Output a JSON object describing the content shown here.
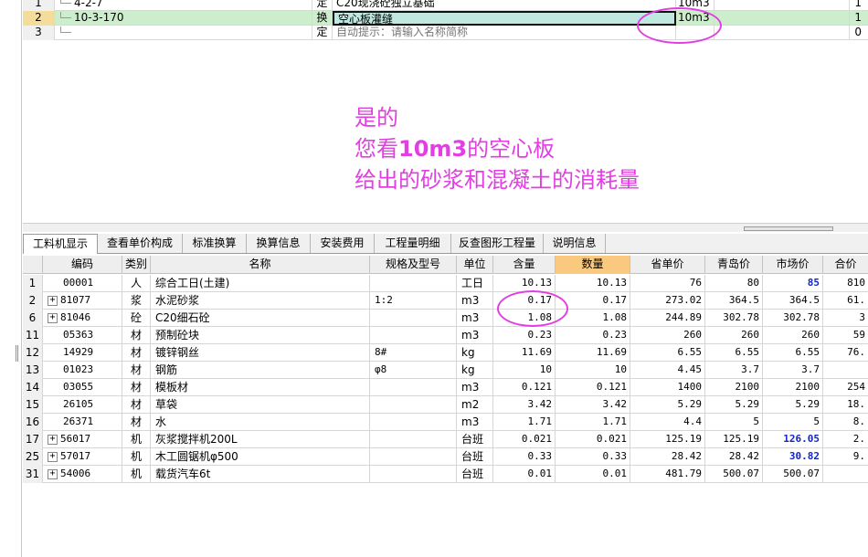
{
  "top_grid": {
    "rows": [
      {
        "num": "1",
        "code": "4-2-7",
        "type": "定",
        "name": "C20现浇砼独立基础",
        "unit": "10m3",
        "qty": "1",
        "selected": false
      },
      {
        "num": "2",
        "code": "10-3-170",
        "type": "换",
        "name": "空心板灌缝",
        "unit": "10m3",
        "qty": "1",
        "selected": true
      },
      {
        "num": "3",
        "code": "",
        "type": "定",
        "name": "自动提示：请输入名称简称",
        "unit": "",
        "qty": "0",
        "selected": false
      }
    ]
  },
  "annotation": {
    "line1": "是的",
    "line2_pre": "您看",
    "line2_bold": "10m3",
    "line2_post": "的空心板",
    "line3": "给出的砂浆和混凝土的消耗量",
    "color": "#e23fe2"
  },
  "tabs": [
    {
      "label": "工料机显示",
      "active": true
    },
    {
      "label": "查看单价构成",
      "active": false
    },
    {
      "label": "标准换算",
      "active": false
    },
    {
      "label": "换算信息",
      "active": false
    },
    {
      "label": "安装费用",
      "active": false
    },
    {
      "label": "工程量明细",
      "active": false
    },
    {
      "label": "反查图形工程量",
      "active": false
    },
    {
      "label": "说明信息",
      "active": false
    }
  ],
  "bottom_grid": {
    "headers": [
      "",
      "编码",
      "类别",
      "名称",
      "规格及型号",
      "单位",
      "含量",
      "数量",
      "省单价",
      "青岛价",
      "市场价",
      "合价"
    ],
    "rows": [
      {
        "rn": "1",
        "expand": false,
        "code": "00001",
        "cat": "人",
        "name": "综合工日(土建)",
        "spec": "",
        "unit": "工日",
        "content": "10.13",
        "qty": "10.13",
        "prov": "76",
        "qd": "80",
        "mkt": "85",
        "mkt_blue": true,
        "total": "810"
      },
      {
        "rn": "2",
        "expand": true,
        "code": "81077",
        "cat": "浆",
        "name": "水泥砂浆",
        "spec": "1:2",
        "unit": "m3",
        "content": "0.17",
        "qty": "0.17",
        "prov": "273.02",
        "qd": "364.5",
        "mkt": "364.5",
        "mkt_blue": false,
        "total": "61."
      },
      {
        "rn": "6",
        "expand": true,
        "code": "81046",
        "cat": "砼",
        "name": "C20细石砼",
        "spec": "",
        "unit": "m3",
        "content": "1.08",
        "qty": "1.08",
        "prov": "244.89",
        "qd": "302.78",
        "mkt": "302.78",
        "mkt_blue": false,
        "total": "3"
      },
      {
        "rn": "11",
        "expand": false,
        "code": "05363",
        "cat": "材",
        "name": "预制砼块",
        "spec": "",
        "unit": "m3",
        "content": "0.23",
        "qty": "0.23",
        "prov": "260",
        "qd": "260",
        "mkt": "260",
        "mkt_blue": false,
        "total": "59"
      },
      {
        "rn": "12",
        "expand": false,
        "code": "14929",
        "cat": "材",
        "name": "镀锌钢丝",
        "spec": "8#",
        "unit": "kg",
        "content": "11.69",
        "qty": "11.69",
        "prov": "6.55",
        "qd": "6.55",
        "mkt": "6.55",
        "mkt_blue": false,
        "total": "76."
      },
      {
        "rn": "13",
        "expand": false,
        "code": "01023",
        "cat": "材",
        "name": "钢筋",
        "spec": "φ8",
        "unit": "kg",
        "content": "10",
        "qty": "10",
        "prov": "4.45",
        "qd": "3.7",
        "mkt": "3.7",
        "mkt_blue": false,
        "total": ""
      },
      {
        "rn": "14",
        "expand": false,
        "code": "03055",
        "cat": "材",
        "name": "模板材",
        "spec": "",
        "unit": "m3",
        "content": "0.121",
        "qty": "0.121",
        "prov": "1400",
        "qd": "2100",
        "mkt": "2100",
        "mkt_blue": false,
        "total": "254"
      },
      {
        "rn": "15",
        "expand": false,
        "code": "26105",
        "cat": "材",
        "name": "草袋",
        "spec": "",
        "unit": "m2",
        "content": "3.42",
        "qty": "3.42",
        "prov": "5.29",
        "qd": "5.29",
        "mkt": "5.29",
        "mkt_blue": false,
        "total": "18."
      },
      {
        "rn": "16",
        "expand": false,
        "code": "26371",
        "cat": "材",
        "name": "水",
        "spec": "",
        "unit": "m3",
        "content": "1.71",
        "qty": "1.71",
        "prov": "4.4",
        "qd": "5",
        "mkt": "5",
        "mkt_blue": false,
        "total": "8."
      },
      {
        "rn": "17",
        "expand": true,
        "code": "56017",
        "cat": "机",
        "name": "灰浆搅拌机200L",
        "spec": "",
        "unit": "台班",
        "content": "0.021",
        "qty": "0.021",
        "prov": "125.19",
        "qd": "125.19",
        "mkt": "126.05",
        "mkt_blue": true,
        "total": "2."
      },
      {
        "rn": "25",
        "expand": true,
        "code": "57017",
        "cat": "机",
        "name": "木工圆锯机φ500",
        "spec": "",
        "unit": "台班",
        "content": "0.33",
        "qty": "0.33",
        "prov": "28.42",
        "qd": "28.42",
        "mkt": "30.82",
        "mkt_blue": true,
        "total": "9."
      },
      {
        "rn": "31",
        "expand": true,
        "code": "54006",
        "cat": "机",
        "name": "载货汽车6t",
        "spec": "",
        "unit": "台班",
        "content": "0.01",
        "qty": "0.01",
        "prov": "481.79",
        "qd": "500.07",
        "mkt": "500.07",
        "mkt_blue": false,
        "total": ""
      }
    ]
  }
}
